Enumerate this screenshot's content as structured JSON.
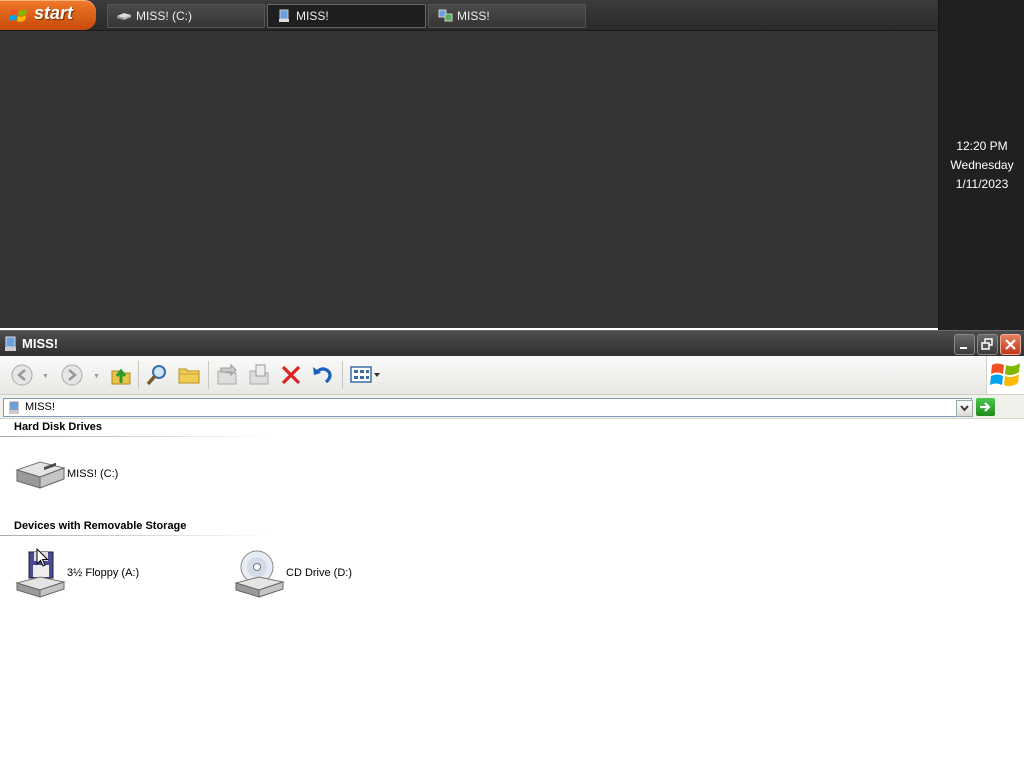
{
  "taskbar": {
    "start_label": "start",
    "buttons": [
      {
        "label": "MISS! (C:)",
        "icon": "hard-drive-icon",
        "active": false
      },
      {
        "label": "MISS!",
        "icon": "computer-icon",
        "active": true
      },
      {
        "label": "MISS!",
        "icon": "network-icon",
        "active": false
      }
    ]
  },
  "clock": {
    "time": "12:20 PM",
    "day": "Wednesday",
    "date": "1/11/2023"
  },
  "window": {
    "title": "MISS!",
    "controls": [
      "minimize",
      "restore",
      "close"
    ],
    "toolbar": [
      "back",
      "forward",
      "up",
      "search",
      "folders",
      "move-to",
      "copy-to",
      "delete",
      "undo",
      "views"
    ],
    "address": {
      "value": "MISS!"
    },
    "groups": [
      {
        "heading": "Hard Disk Drives",
        "items": [
          {
            "label": "MISS! (C:)",
            "icon": "hard-drive-icon"
          }
        ]
      },
      {
        "heading": "Devices with Removable Storage",
        "items": [
          {
            "label": "3½ Floppy (A:)",
            "icon": "floppy-drive-icon"
          },
          {
            "label": "CD Drive (D:)",
            "icon": "cd-drive-icon"
          }
        ]
      }
    ]
  },
  "colors": {
    "start_orange": "#e0661a",
    "taskbar_dark": "#2f2f2f",
    "desktop": "#353535",
    "close_red": "#d04a28"
  }
}
